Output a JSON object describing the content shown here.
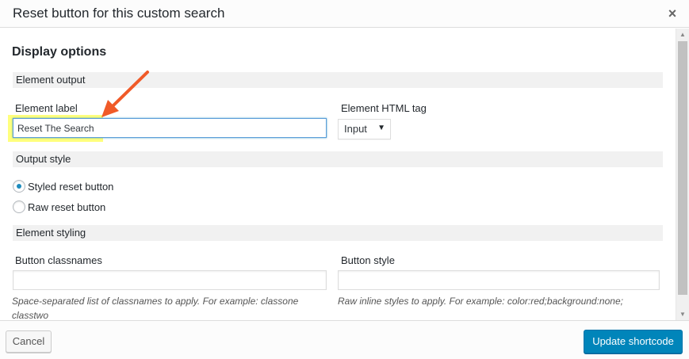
{
  "modal": {
    "title": "Reset button for this custom search",
    "close_symbol": "×"
  },
  "content": {
    "section_title": "Display options",
    "groups": {
      "element_output": "Element output",
      "output_style": "Output style",
      "element_styling": "Element styling"
    },
    "element_label": {
      "label": "Element label",
      "value": "Reset The Search"
    },
    "element_html_tag": {
      "label": "Element HTML tag",
      "selected": "Input"
    },
    "radios": [
      {
        "label": "Styled reset button",
        "checked": true
      },
      {
        "label": "Raw reset button",
        "checked": false
      }
    ],
    "button_classnames": {
      "label": "Button classnames",
      "value": "",
      "hint": "Space-separated list of classnames to apply. For example: classone classtwo"
    },
    "button_style": {
      "label": "Button style",
      "value": "",
      "hint": "Raw inline styles to apply. For example: color:red;background:none;"
    }
  },
  "footer": {
    "cancel_label": "Cancel",
    "primary_label": "Update shortcode"
  },
  "annotation": {
    "arrow_color": "#f05a28",
    "highlight_color": "#ffff66"
  },
  "colors": {
    "primary": "#0085ba",
    "focus_border": "#5b9dd9"
  }
}
